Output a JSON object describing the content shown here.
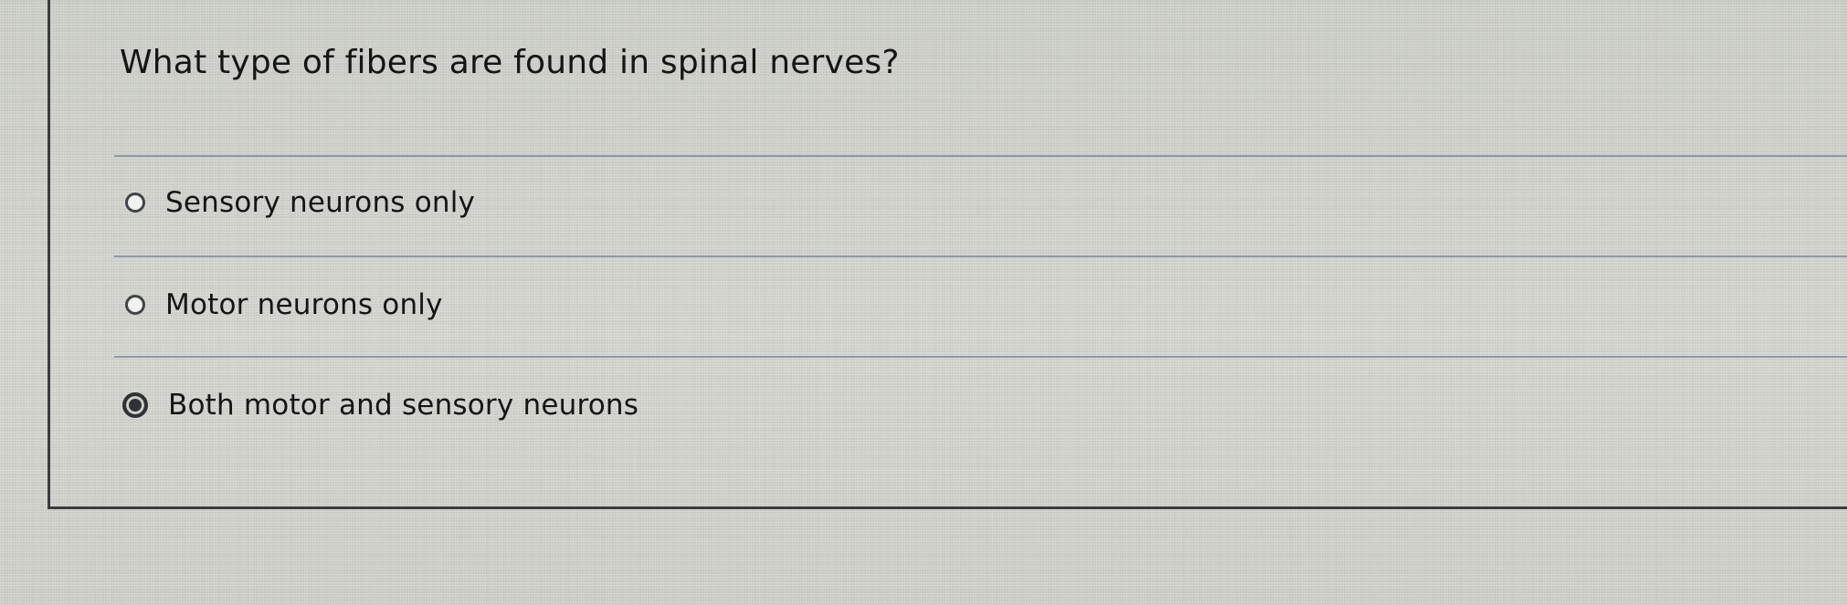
{
  "question": {
    "text": "What type of fibers are found in spinal nerves?"
  },
  "options": [
    {
      "label": "Sensory neurons only",
      "selected": false
    },
    {
      "label": "Motor neurons only",
      "selected": false
    },
    {
      "label": "Both motor and sensory neurons",
      "selected": true
    }
  ]
}
